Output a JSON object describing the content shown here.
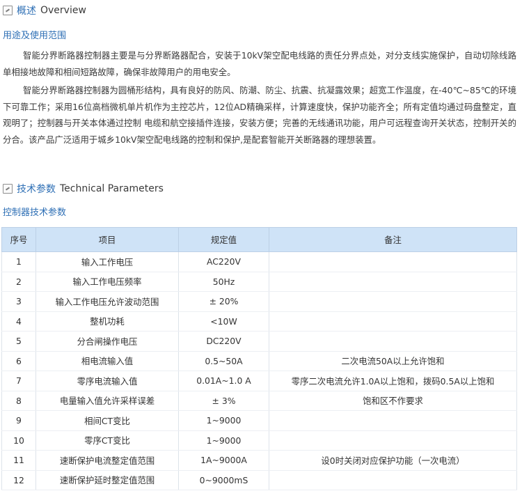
{
  "overview": {
    "title": "概述",
    "title_en": "Overview",
    "subheading": "用途及使用范围",
    "paragraphs": [
      "智能分界断路器控制器主要是与分界断路器配合，安装于10kV架空配电线路的责任分界点处，对分支线实施保护，自动切除线路单相接地故障和相间短路故障，确保非故障用户的用电安全。",
      "智能分界断路器控制器为圆桶形结构，具有良好的防风、防潮、防尘、抗震、抗凝露效果；超宽工作温度，在-40℃~85℃的环境下可靠工作；采用16位高档微机单片机作为主控芯片，12位AD精确采样，计算速度快，保护功能齐全；所有定值均通过码盘整定，直观明了；控制器与开关本体通过控制 电缆和航空接插件连接，安装方便；完善的无线通讯功能，用户可远程查询开关状态，控制开关的分合。该产品广泛适用于城乡10kV架空配电线路的控制和保护,是配套智能开关断路器的理想装置。"
    ]
  },
  "technical": {
    "title": "技术参数",
    "title_en": "Technical Parameters",
    "subheading": "控制器技术参数"
  },
  "table": {
    "headers": [
      "序号",
      "项目",
      "规定值",
      "备注"
    ],
    "rows": [
      [
        "1",
        "输入工作电压",
        "AC220V",
        ""
      ],
      [
        "2",
        "输入工作电压频率",
        "50Hz",
        ""
      ],
      [
        "3",
        "输入工作电压允许波动范围",
        "± 20%",
        ""
      ],
      [
        "4",
        "整机功耗",
        "<10W",
        ""
      ],
      [
        "5",
        "分合闸操作电压",
        "DC220V",
        ""
      ],
      [
        "6",
        "相电流输入值",
        "0.5~50A",
        "二次电流50A以上允许饱和"
      ],
      [
        "7",
        "零序电流输入值",
        "0.01A~1.0 A",
        "零序二次电流允许1.0A以上饱和，拨码0.5A以上饱和"
      ],
      [
        "8",
        "电量输入值允许采样误差",
        "± 3%",
        "饱和区不作要求"
      ],
      [
        "9",
        "相间CT变比",
        "1~9000",
        ""
      ],
      [
        "10",
        "零序CT变比",
        "1~9000",
        ""
      ],
      [
        "11",
        "速断保护电流整定值范围",
        "1A~9000A",
        "设0时关闭对应保护功能（一次电流）"
      ],
      [
        "12",
        "速断保护延时整定值范围",
        "0~9000mS",
        ""
      ]
    ]
  },
  "colors": {
    "accent": "#2e6fb5",
    "header_bg": "#cfe3f7"
  }
}
